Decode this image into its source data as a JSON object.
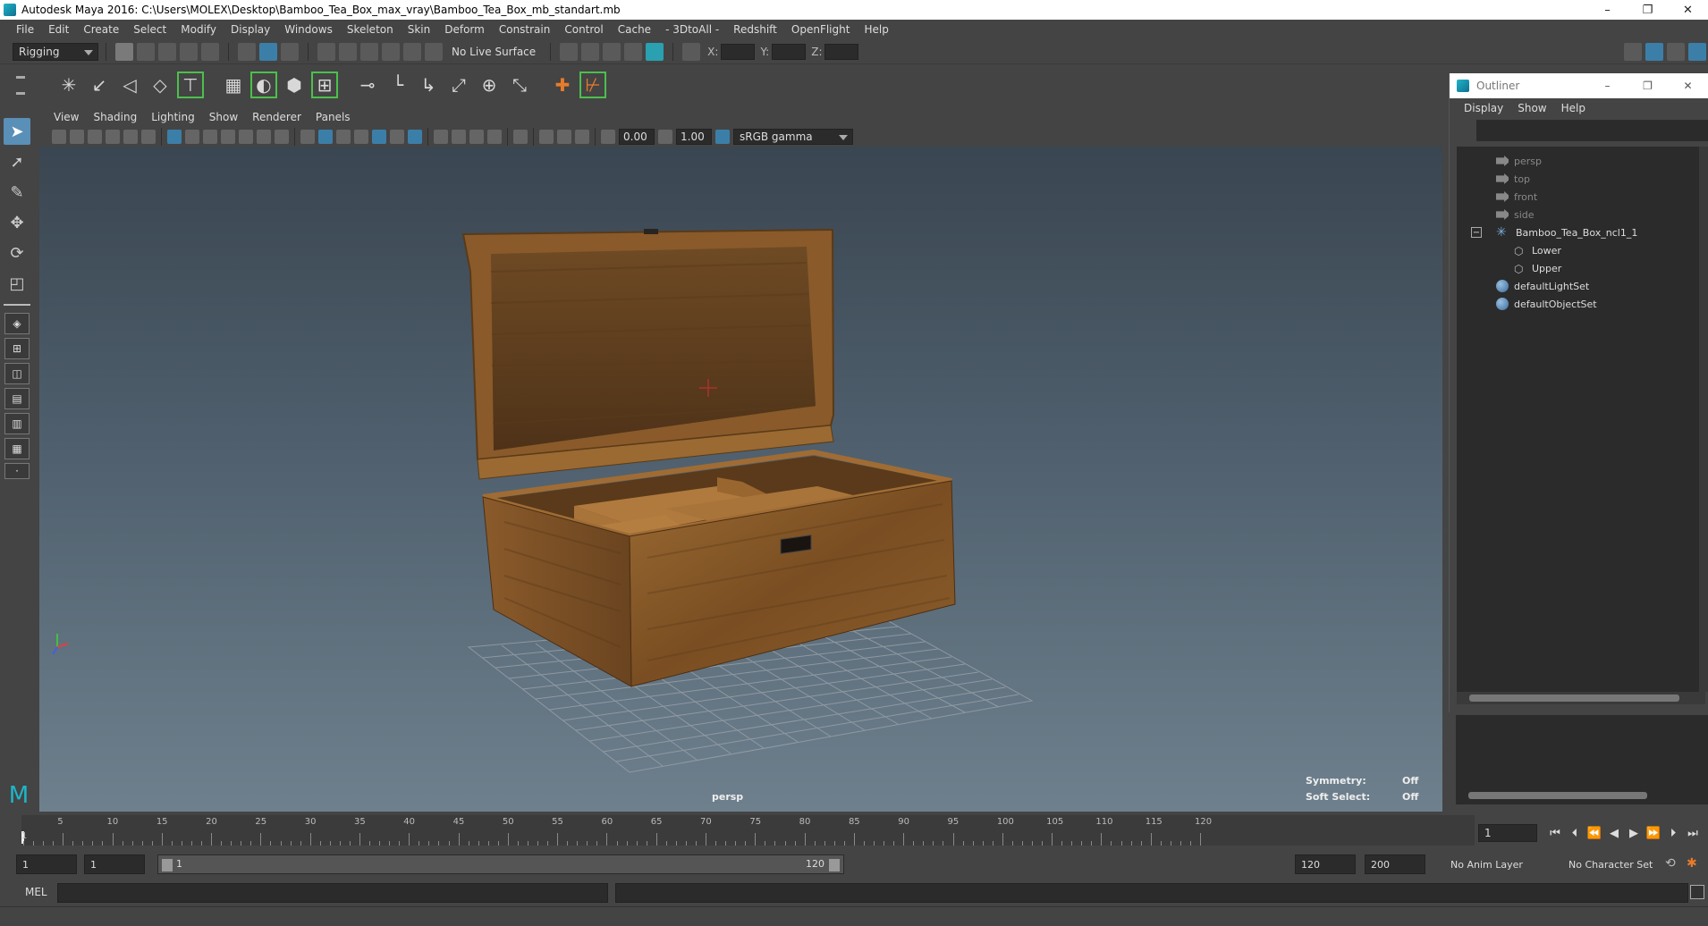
{
  "window": {
    "title": "Autodesk Maya 2016: C:\\Users\\MOLEX\\Desktop\\Bamboo_Tea_Box_max_vray\\Bamboo_Tea_Box_mb_standart.mb",
    "minimize": "–",
    "restore": "❐",
    "close": "✕"
  },
  "menubar": [
    "File",
    "Edit",
    "Create",
    "Select",
    "Modify",
    "Display",
    "Windows",
    "Skeleton",
    "Skin",
    "Deform",
    "Constrain",
    "Control",
    "Cache",
    "- 3DtoAll -",
    "Redshift",
    "OpenFlight",
    "Help"
  ],
  "status_line": {
    "menu_set": "Rigging",
    "live_surface": "No Live Surface",
    "x_label": "X:",
    "y_label": "Y:",
    "z_label": "Z:"
  },
  "panel": {
    "menu": [
      "View",
      "Shading",
      "Lighting",
      "Show",
      "Renderer",
      "Panels"
    ],
    "exposure": "0.00",
    "gamma": "1.00",
    "color_space": "sRGB gamma",
    "camera_label": "persp",
    "hud": {
      "symmetry_label": "Symmetry:",
      "symmetry_value": "Off",
      "soft_select_label": "Soft Select:",
      "soft_select_value": "Off"
    }
  },
  "outliner": {
    "title": "Outliner",
    "menu": [
      "Display",
      "Show",
      "Help"
    ],
    "items": [
      {
        "label": "persp",
        "type": "camera",
        "indent": 0
      },
      {
        "label": "top",
        "type": "camera",
        "indent": 0
      },
      {
        "label": "front",
        "type": "camera",
        "indent": 0
      },
      {
        "label": "side",
        "type": "camera",
        "indent": 0
      },
      {
        "label": "Bamboo_Tea_Box_ncl1_1",
        "type": "group",
        "indent": 0,
        "expanded": true
      },
      {
        "label": "Lower",
        "type": "mesh",
        "indent": 1
      },
      {
        "label": "Upper",
        "type": "mesh",
        "indent": 1
      },
      {
        "label": "defaultLightSet",
        "type": "set",
        "indent": 0
      },
      {
        "label": "defaultObjectSet",
        "type": "set",
        "indent": 0
      }
    ]
  },
  "timeline": {
    "ticks": [
      "5",
      "10",
      "15",
      "20",
      "25",
      "30",
      "35",
      "40",
      "45",
      "50",
      "55",
      "60",
      "65",
      "70",
      "75",
      "80",
      "85",
      "90",
      "95",
      "100",
      "105",
      "110",
      "115",
      "120"
    ],
    "start_tick": "1",
    "current_frame": "1"
  },
  "range": {
    "start_frame": "1",
    "playback_start": "1",
    "range_start": "1",
    "range_end": "120",
    "playback_end": "120",
    "end_frame": "200",
    "anim_layer": "No Anim Layer",
    "character_set": "No Character Set"
  },
  "command_line": {
    "language": "MEL"
  },
  "colors": {
    "accent": "#1fb5c8",
    "highlight_green": "#4cc04c",
    "orange": "#e77b2a",
    "wood": "#8a5a2a"
  }
}
